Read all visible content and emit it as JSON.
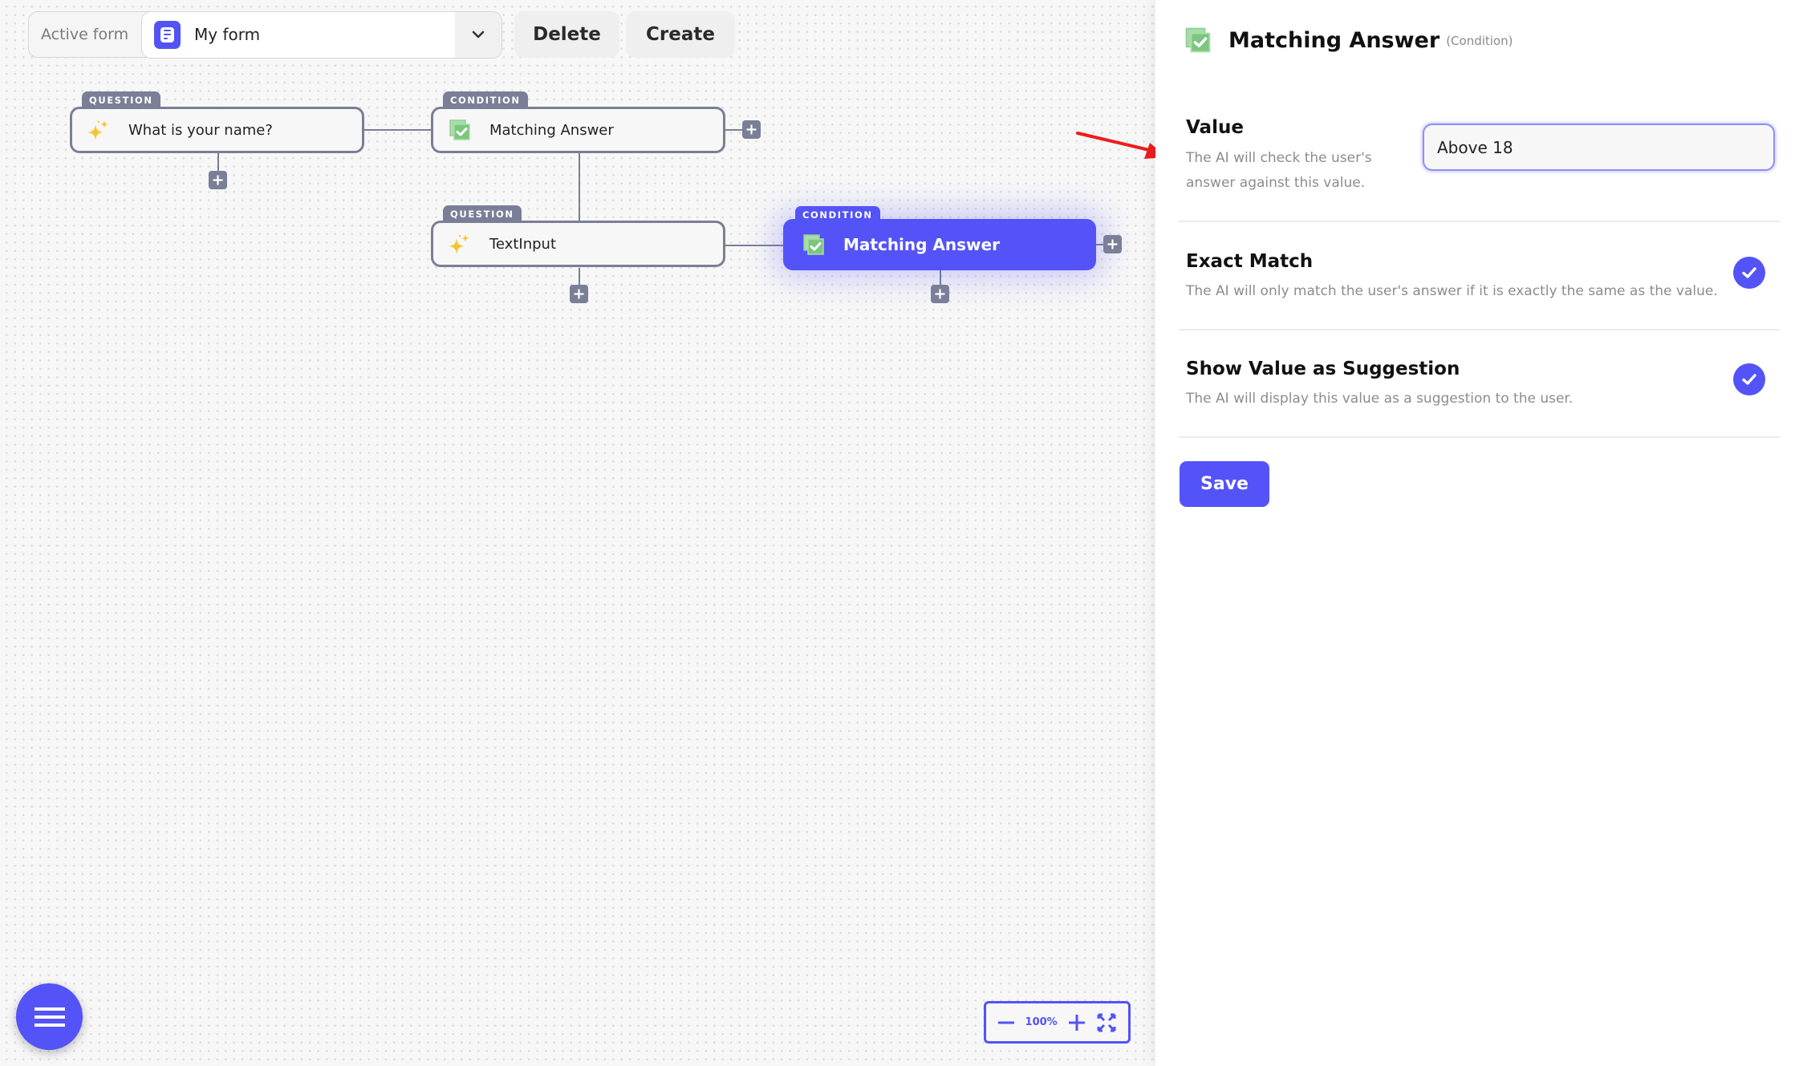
{
  "toolbar": {
    "active_form_label": "Active form",
    "selected_form": "My form",
    "delete_label": "Delete",
    "create_label": "Create"
  },
  "canvas": {
    "nodes": [
      {
        "type_tag": "QUESTION",
        "label": "What is your name?",
        "icon": "sparkles-icon",
        "selected": false
      },
      {
        "type_tag": "CONDITION",
        "label": "Matching Answer",
        "icon": "checkbox-check-icon",
        "selected": false
      },
      {
        "type_tag": "QUESTION",
        "label": "TextInput",
        "icon": "sparkles-icon",
        "selected": false
      },
      {
        "type_tag": "CONDITION",
        "label": "Matching Answer",
        "icon": "checkbox-check-icon",
        "selected": true
      }
    ],
    "zoom_level": "100%"
  },
  "panel": {
    "title": "Matching Answer",
    "subtitle": "(Condition)",
    "value": {
      "title": "Value",
      "description": "The AI will check the user's answer against this value.",
      "input_value": "Above 18"
    },
    "exact_match": {
      "title": "Exact Match",
      "description": "The AI will only match the user's answer if it is exactly the same as the value.",
      "checked": true
    },
    "show_suggestion": {
      "title": "Show Value as Suggestion",
      "description": "The AI will display this value as a suggestion to the user.",
      "checked": true
    },
    "save_label": "Save"
  },
  "colors": {
    "accent": "#5353f8",
    "node_border": "#7a7e97",
    "condition_icon": "#7cc67e",
    "annotation_arrow": "#ee1c1c"
  }
}
